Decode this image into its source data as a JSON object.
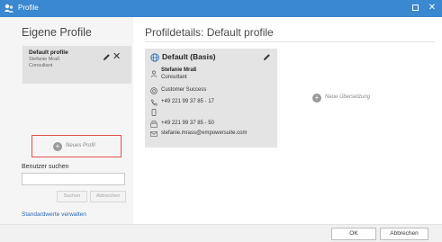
{
  "window": {
    "title": "Profile",
    "app_icon": "profile-app-icon",
    "maximize_icon": "maximize-icon",
    "close_icon": "close-icon",
    "close_glyph": "✕",
    "titlebar_color": "#3a88cf"
  },
  "sidebar": {
    "heading": "Eigene Profile",
    "profiles": [
      {
        "name": "Default profile",
        "user": "Stefanie Mraß",
        "role": "Consultant",
        "edit_icon": "pencil-icon",
        "delete_glyph": "✕"
      }
    ],
    "new_profile_label": "Neues Profil",
    "new_profile_plus": "+",
    "search_label": "Benutzer suchen",
    "search_value": "",
    "search_button": "Suchen",
    "cancel_search_button": "Abbrechen",
    "defaults_link": "Standardwerte verwalten",
    "new_profile_border_color": "#e0504c"
  },
  "main": {
    "heading": "Profildetails: Default profile",
    "card": {
      "title": "Default (Basis)",
      "title_icon": "globe-icon",
      "edit_icon": "pencil-icon",
      "user_name": "Stefanie Mraß",
      "user_role": "Consultant",
      "department": "Customer Success",
      "phone": "+49 221 99 37 85 - 17",
      "fax": "+49 221 99 37 85 - 50",
      "email": "stefanie.mrass@empowersuite.com",
      "icons": [
        "person-icon",
        "department-icon",
        "phone-icon",
        "mobile-icon",
        "fax-icon",
        "email-icon"
      ]
    },
    "new_translation_label": "Neue Übersetzung",
    "new_translation_plus": "+"
  },
  "footer": {
    "ok_label": "OK",
    "cancel_label": "Abbrechen"
  }
}
